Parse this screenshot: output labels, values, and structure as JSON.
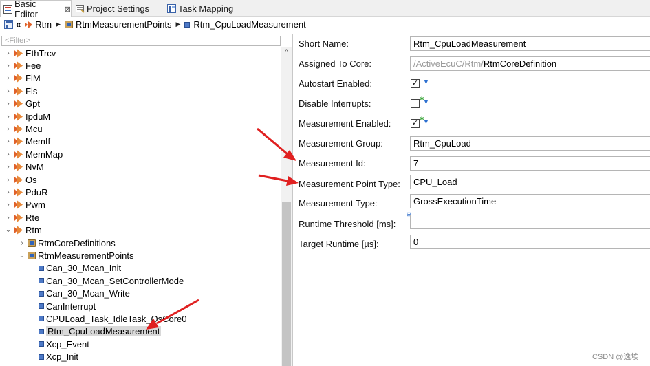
{
  "tabs": [
    {
      "label": "Basic Editor",
      "close": "⊠",
      "icon": "basic-editor-icon",
      "active": true
    },
    {
      "label": "Project Settings",
      "icon": "project-settings-icon",
      "active": false
    },
    {
      "label": "Task Mapping",
      "icon": "task-mapping-icon",
      "active": false
    }
  ],
  "breadcrumb": {
    "back": "«",
    "items": [
      "Rtm",
      "RtmMeasurementPoints",
      "Rtm_CpuLoadMeasurement"
    ]
  },
  "filter": {
    "placeholder": "<Filter>"
  },
  "tree": [
    {
      "label": "EthTrcv",
      "level": 0,
      "chevron": "›",
      "icon": "module-icon"
    },
    {
      "label": "Fee",
      "level": 0,
      "chevron": "›",
      "icon": "module-icon"
    },
    {
      "label": "FiM",
      "level": 0,
      "chevron": "›",
      "icon": "module-icon"
    },
    {
      "label": "Fls",
      "level": 0,
      "chevron": "›",
      "icon": "module-icon"
    },
    {
      "label": "Gpt",
      "level": 0,
      "chevron": "›",
      "icon": "module-icon"
    },
    {
      "label": "IpduM",
      "level": 0,
      "chevron": "›",
      "icon": "module-icon"
    },
    {
      "label": "Mcu",
      "level": 0,
      "chevron": "›",
      "icon": "module-icon"
    },
    {
      "label": "MemIf",
      "level": 0,
      "chevron": "›",
      "icon": "module-icon"
    },
    {
      "label": "MemMap",
      "level": 0,
      "chevron": "›",
      "icon": "module-icon"
    },
    {
      "label": "NvM",
      "level": 0,
      "chevron": "›",
      "icon": "module-icon"
    },
    {
      "label": "Os",
      "level": 0,
      "chevron": "›",
      "icon": "module-icon"
    },
    {
      "label": "PduR",
      "level": 0,
      "chevron": "›",
      "icon": "module-icon"
    },
    {
      "label": "Pwm",
      "level": 0,
      "chevron": "›",
      "icon": "module-icon"
    },
    {
      "label": "Rte",
      "level": 0,
      "chevron": "›",
      "icon": "module-icon"
    },
    {
      "label": "Rtm",
      "level": 0,
      "chevron": "⌄",
      "icon": "module-icon"
    },
    {
      "label": "RtmCoreDefinitions",
      "level": 1,
      "chevron": "›",
      "icon": "folder-icon"
    },
    {
      "label": "RtmMeasurementPoints",
      "level": 1,
      "chevron": "⌄",
      "icon": "folder-icon"
    },
    {
      "label": "Can_30_Mcan_Init",
      "level": 2,
      "chevron": "",
      "icon": "container-icon"
    },
    {
      "label": "Can_30_Mcan_SetControllerMode",
      "level": 2,
      "chevron": "",
      "icon": "container-icon"
    },
    {
      "label": "Can_30_Mcan_Write",
      "level": 2,
      "chevron": "",
      "icon": "container-icon"
    },
    {
      "label": "CanInterrupt",
      "level": 2,
      "chevron": "",
      "icon": "container-icon"
    },
    {
      "label": "CPULoad_Task_IdleTask_OsCore0",
      "level": 2,
      "chevron": "",
      "icon": "container-icon"
    },
    {
      "label": "Rtm_CpuLoadMeasurement",
      "level": 2,
      "chevron": "",
      "icon": "container-icon",
      "selected": true
    },
    {
      "label": "Xcp_Event",
      "level": 2,
      "chevron": "",
      "icon": "container-icon"
    },
    {
      "label": "Xcp_Init",
      "level": 2,
      "chevron": "",
      "icon": "container-icon"
    }
  ],
  "form": {
    "short_name": {
      "label": "Short Name:",
      "value": "Rtm_CpuLoadMeasurement"
    },
    "assigned_core": {
      "label": "Assigned To Core:",
      "prefix": "/ActiveEcuC/Rtm/",
      "value": "RtmCoreDefinition"
    },
    "autostart": {
      "label": "Autostart Enabled:",
      "mark": "✓"
    },
    "disable_interrupts": {
      "label": "Disable Interrupts:",
      "mark": ""
    },
    "measurement_enabled": {
      "label": "Measurement Enabled:",
      "mark": "✓"
    },
    "measurement_group": {
      "label": "Measurement Group:",
      "value": "Rtm_CpuLoad"
    },
    "measurement_id": {
      "label": "Measurement Id:",
      "value": "7"
    },
    "measurement_point_type": {
      "label": "Measurement Point Type:",
      "value": "CPU_Load"
    },
    "measurement_type": {
      "label": "Measurement Type:",
      "value": "GrossExecutionTime"
    },
    "runtime_threshold": {
      "label": "Runtime Threshold [ms]:",
      "value": ""
    },
    "target_runtime": {
      "label": "Target Runtime [µs]:",
      "value": "0"
    }
  },
  "colors": {
    "annotation_arrow": "#e02020",
    "selection": "#d9d9d9",
    "link_blue": "#2c6fd0"
  },
  "watermark": "CSDN @逸埃"
}
